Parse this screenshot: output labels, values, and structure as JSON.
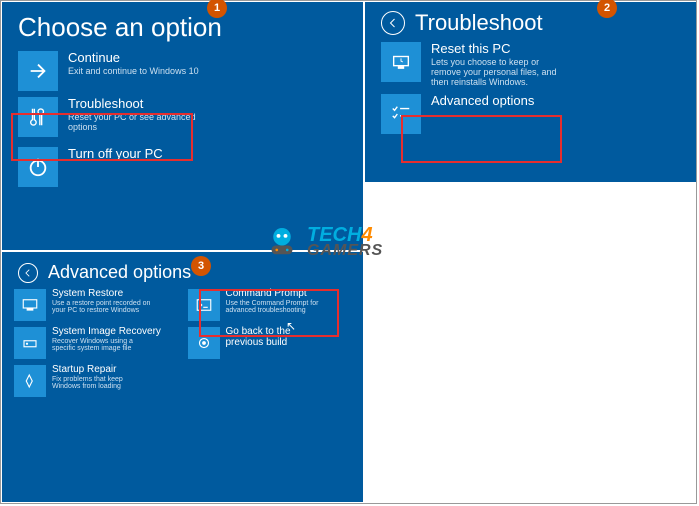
{
  "badges": {
    "b1": "1",
    "b2": "2",
    "b3": "3"
  },
  "panel1": {
    "title": "Choose an option",
    "continue": {
      "title": "Continue",
      "desc": "Exit and continue to Windows 10"
    },
    "troubleshoot": {
      "title": "Troubleshoot",
      "desc": "Reset your PC or see advanced options"
    },
    "poweroff": {
      "title": "Turn off your PC"
    }
  },
  "panel2": {
    "title": "Troubleshoot",
    "reset": {
      "title": "Reset this PC",
      "desc": "Lets you choose to keep or remove your personal files, and then reinstalls Windows."
    },
    "advanced": {
      "title": "Advanced options"
    }
  },
  "panel3": {
    "title": "Advanced options",
    "restore": {
      "title": "System Restore",
      "desc": "Use a restore point recorded on your PC to restore Windows"
    },
    "image": {
      "title": "System Image Recovery",
      "desc": "Recover Windows using a specific system image file"
    },
    "startup": {
      "title": "Startup Repair",
      "desc": "Fix problems that keep Windows from loading"
    },
    "cmd": {
      "title": "Command Prompt",
      "desc": "Use the Command Prompt for advanced troubleshooting"
    },
    "goback": {
      "title": "Go back to the previous build"
    }
  },
  "logo": {
    "tech": "TECH",
    "four": "4",
    "gamers": "GAMERS"
  }
}
